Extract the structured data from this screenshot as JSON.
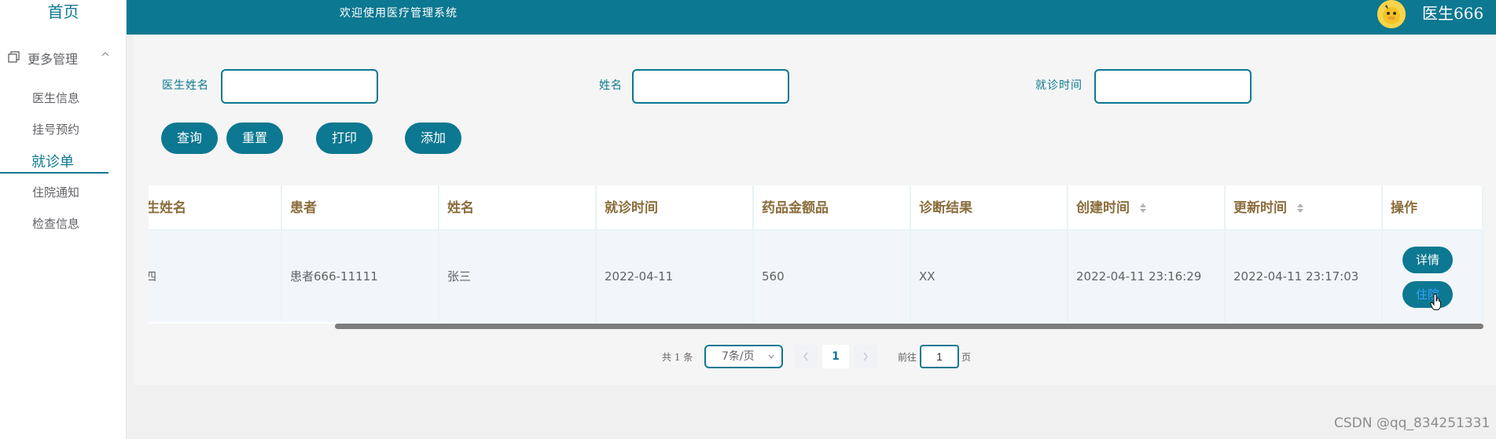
{
  "app": {
    "home_label": "首页",
    "welcome": "欢迎使用医疗管理系统",
    "user": "医生666"
  },
  "sidebar": {
    "group_label": "更多管理",
    "items": [
      {
        "label": "医生信息"
      },
      {
        "label": "挂号预约"
      },
      {
        "label": "就诊单",
        "active": true
      },
      {
        "label": "住院通知"
      },
      {
        "label": "检查信息"
      }
    ]
  },
  "search": {
    "fields": [
      {
        "label": "医生姓名",
        "value": ""
      },
      {
        "label": "姓名",
        "value": ""
      },
      {
        "label": "就诊时间",
        "value": ""
      }
    ]
  },
  "buttons": {
    "query": "查询",
    "reset": "重置",
    "print": "打印",
    "add": "添加"
  },
  "table": {
    "headers": [
      "医生姓名",
      "患者",
      "姓名",
      "就诊时间",
      "药品金额品",
      "诊断结果",
      "创建时间",
      "更新时间",
      "操作"
    ],
    "rows": [
      {
        "doctor_name": "李四",
        "patient": "患者666-11111",
        "name": "张三",
        "visit_time": "2022-04-11",
        "amount": "560",
        "diagnosis": "XX",
        "created": "2022-04-11 23:16:29",
        "updated": "2022-04-11 23:17:03",
        "actions": [
          "详情",
          "住院"
        ]
      }
    ]
  },
  "pagination": {
    "total": "共 1 条",
    "page_size": "7条/页",
    "current_page": "1",
    "goto_label": "前往",
    "goto_value": "1",
    "page_unit": "页"
  },
  "watermark": "CSDN @qq_834251331",
  "colors": {
    "primary": "#0c7891",
    "header_text": "#8a6d3b"
  }
}
